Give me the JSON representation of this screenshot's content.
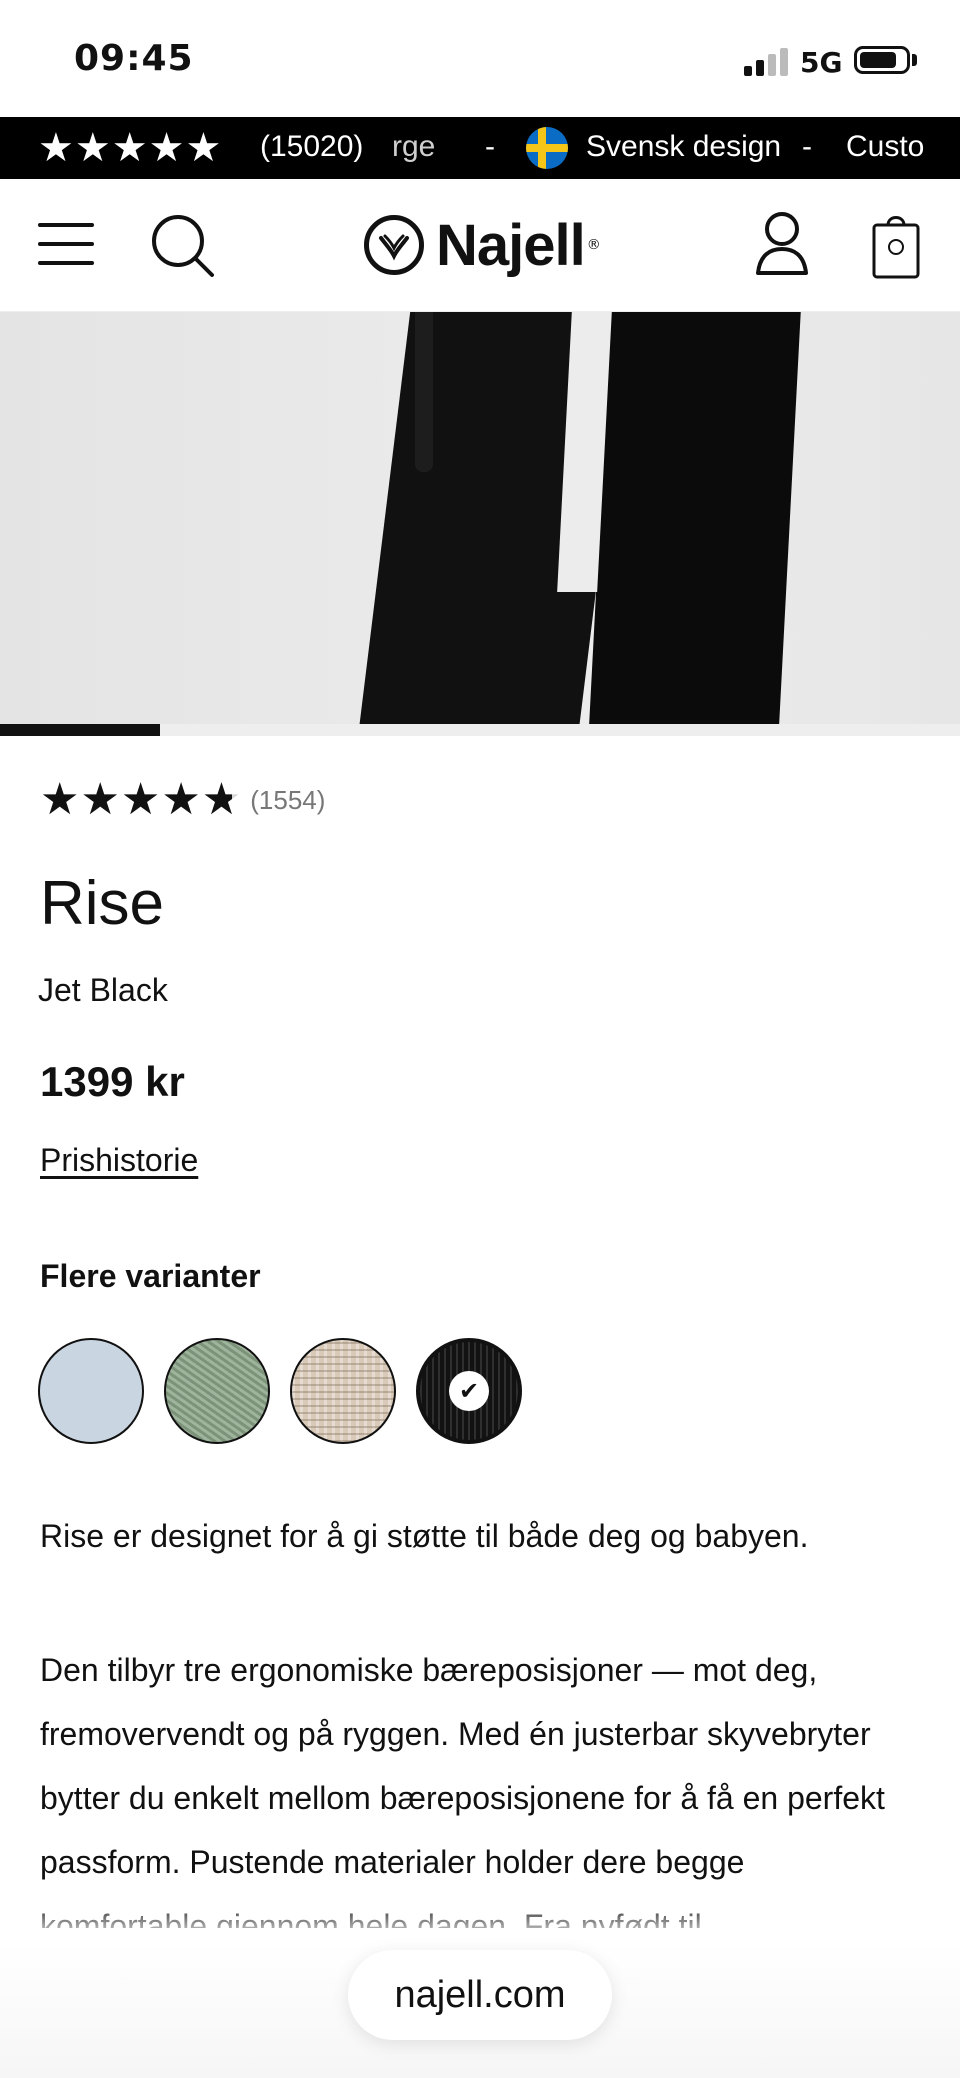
{
  "status_bar": {
    "time": "09:45",
    "network": "5G"
  },
  "announcement": {
    "stars": "★★★★★",
    "review_count": "(15020)",
    "segment_partial": "rge",
    "separator": "-",
    "segment_main": "Svensk design",
    "segment_trailing": "Custo"
  },
  "header": {
    "logo_text": "Najell",
    "logo_mark": "®"
  },
  "product": {
    "rating_stars": "★★★★★",
    "rating_count": "(1554)",
    "rating_value_fraction": 0.95,
    "title": "Rise",
    "variant": "Jet Black",
    "price": "1399 kr",
    "price_history_link": "Prishistorie",
    "variants_heading": "Flere varianter",
    "swatches": [
      {
        "name": "light-blue",
        "color": "#c9d6e2",
        "selected": false
      },
      {
        "name": "sage-green",
        "color": "#8aa387",
        "selected": false
      },
      {
        "name": "beige",
        "color": "#d8c9b8",
        "selected": false
      },
      {
        "name": "jet-black",
        "color": "#121212",
        "selected": true,
        "check": "✔"
      }
    ],
    "description_short": "Rise er designet for å gi støtte til både deg og babyen.",
    "description_long": "Den tilbyr tre ergonomiske bæreposisjoner — mot deg, fremovervendt og på ryggen. Med én justerbar skyvebryter bytter du enkelt mellom bæreposisjonene for å få en perfekt passform. Pustende materialer holder dere begge komfortable gjennom hele dagen. Fra nyfødt til"
  },
  "gallery": {
    "progress_fraction": 0.167
  },
  "browser": {
    "url": "najell.com"
  },
  "colors": {
    "announcement_bg": "#000000",
    "text": "#111111",
    "muted": "#777777"
  }
}
